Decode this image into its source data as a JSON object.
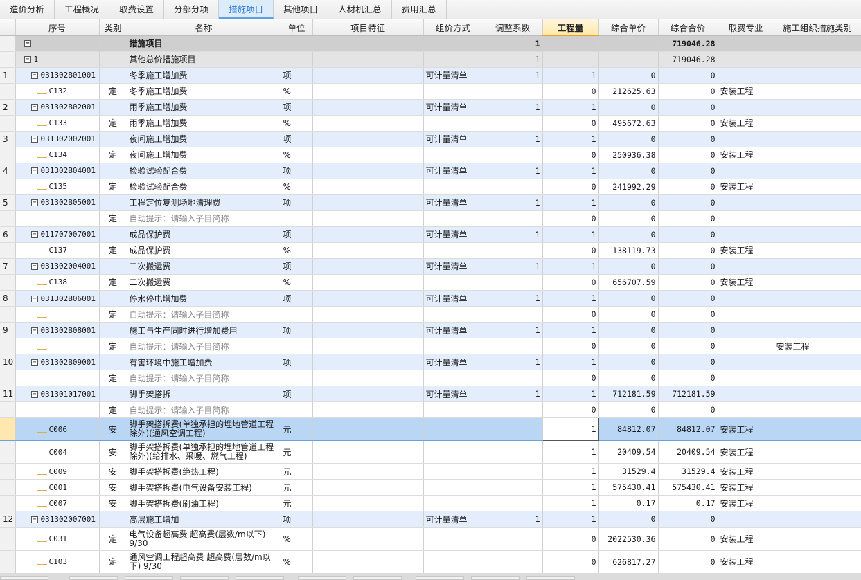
{
  "tabs": [
    {
      "label": "造价分析",
      "active": false
    },
    {
      "label": "工程概况",
      "active": false
    },
    {
      "label": "取费设置",
      "active": false
    },
    {
      "label": "分部分项",
      "active": false
    },
    {
      "label": "措施项目",
      "active": true
    },
    {
      "label": "其他项目",
      "active": false
    },
    {
      "label": "人材机汇总",
      "active": false
    },
    {
      "label": "费用汇总",
      "active": false
    }
  ],
  "columns": {
    "seq": "序号",
    "cat": "类别",
    "name": "名称",
    "unit": "单位",
    "feat": "项目特征",
    "method": "组价方式",
    "coef": "调整系数",
    "qty": "工程量",
    "price": "综合单价",
    "total": "综合合价",
    "spec": "取费专业",
    "org": "施工组织措施类别"
  },
  "rows": [
    {
      "idx": "",
      "type": "head",
      "seq": "",
      "cat": "",
      "name": "措施项目",
      "unit": "",
      "feat": "",
      "method": "",
      "coef": "1",
      "qty": "",
      "price": "",
      "total": "719046.28",
      "spec": "",
      "org": ""
    },
    {
      "idx": "",
      "type": "group",
      "seq": "1",
      "cat": "",
      "name": "其他总价措施项目",
      "unit": "",
      "feat": "",
      "method": "",
      "coef": "1",
      "qty": "",
      "price": "",
      "total": "719046.28",
      "spec": "",
      "org": ""
    },
    {
      "idx": "1",
      "type": "list",
      "seq": "031302B01001",
      "cat": "",
      "name": "冬季施工增加费",
      "unit": "项",
      "feat": "",
      "method": "可计量清单",
      "coef": "1",
      "qty": "1",
      "price": "0",
      "total": "0",
      "spec": "",
      "org": ""
    },
    {
      "idx": "",
      "type": "sub",
      "seq": "C132",
      "cat": "定",
      "name": "冬季施工增加费",
      "unit": "%",
      "feat": "",
      "method": "",
      "coef": "",
      "qty": "0",
      "price": "212625.63",
      "total": "0",
      "spec": "安装工程",
      "org": ""
    },
    {
      "idx": "2",
      "type": "list",
      "seq": "031302B02001",
      "cat": "",
      "name": "雨季施工增加费",
      "unit": "项",
      "feat": "",
      "method": "可计量清单",
      "coef": "1",
      "qty": "1",
      "price": "0",
      "total": "0",
      "spec": "",
      "org": ""
    },
    {
      "idx": "",
      "type": "sub",
      "seq": "C133",
      "cat": "定",
      "name": "雨季施工增加费",
      "unit": "%",
      "feat": "",
      "method": "",
      "coef": "",
      "qty": "0",
      "price": "495672.63",
      "total": "0",
      "spec": "安装工程",
      "org": ""
    },
    {
      "idx": "3",
      "type": "list",
      "seq": "031302002001",
      "cat": "",
      "name": "夜间施工增加费",
      "unit": "项",
      "feat": "",
      "method": "可计量清单",
      "coef": "1",
      "qty": "1",
      "price": "0",
      "total": "0",
      "spec": "",
      "org": ""
    },
    {
      "idx": "",
      "type": "sub",
      "seq": "C134",
      "cat": "定",
      "name": "夜间施工增加费",
      "unit": "%",
      "feat": "",
      "method": "",
      "coef": "",
      "qty": "0",
      "price": "250936.38",
      "total": "0",
      "spec": "安装工程",
      "org": ""
    },
    {
      "idx": "4",
      "type": "list",
      "seq": "031302B04001",
      "cat": "",
      "name": "检验试验配合费",
      "unit": "项",
      "feat": "",
      "method": "可计量清单",
      "coef": "1",
      "qty": "1",
      "price": "0",
      "total": "0",
      "spec": "",
      "org": ""
    },
    {
      "idx": "",
      "type": "sub",
      "seq": "C135",
      "cat": "定",
      "name": "检验试验配合费",
      "unit": "%",
      "feat": "",
      "method": "",
      "coef": "",
      "qty": "0",
      "price": "241992.29",
      "total": "0",
      "spec": "安装工程",
      "org": ""
    },
    {
      "idx": "5",
      "type": "list",
      "seq": "031302B05001",
      "cat": "",
      "name": "工程定位复测场地清理费",
      "unit": "项",
      "feat": "",
      "method": "可计量清单",
      "coef": "1",
      "qty": "1",
      "price": "0",
      "total": "0",
      "spec": "",
      "org": ""
    },
    {
      "idx": "",
      "type": "sub",
      "seq": "",
      "cat": "定",
      "name": "自动提示：请输入子目简称",
      "hint": true,
      "unit": "",
      "feat": "",
      "method": "",
      "coef": "",
      "qty": "0",
      "price": "0",
      "total": "0",
      "spec": "",
      "org": ""
    },
    {
      "idx": "6",
      "type": "list",
      "seq": "011707007001",
      "cat": "",
      "name": "成品保护费",
      "unit": "项",
      "feat": "",
      "method": "可计量清单",
      "coef": "1",
      "qty": "1",
      "price": "0",
      "total": "0",
      "spec": "",
      "org": ""
    },
    {
      "idx": "",
      "type": "sub",
      "seq": "C137",
      "cat": "定",
      "name": "成品保护费",
      "unit": "%",
      "feat": "",
      "method": "",
      "coef": "",
      "qty": "0",
      "price": "138119.73",
      "total": "0",
      "spec": "安装工程",
      "org": ""
    },
    {
      "idx": "7",
      "type": "list",
      "seq": "031302004001",
      "cat": "",
      "name": "二次搬运费",
      "unit": "项",
      "feat": "",
      "method": "可计量清单",
      "coef": "1",
      "qty": "1",
      "price": "0",
      "total": "0",
      "spec": "",
      "org": ""
    },
    {
      "idx": "",
      "type": "sub",
      "seq": "C138",
      "cat": "定",
      "name": "二次搬运费",
      "unit": "%",
      "feat": "",
      "method": "",
      "coef": "",
      "qty": "0",
      "price": "656707.59",
      "total": "0",
      "spec": "安装工程",
      "org": ""
    },
    {
      "idx": "8",
      "type": "list",
      "seq": "031302B06001",
      "cat": "",
      "name": "停水停电增加费",
      "unit": "项",
      "feat": "",
      "method": "可计量清单",
      "coef": "1",
      "qty": "1",
      "price": "0",
      "total": "0",
      "spec": "",
      "org": ""
    },
    {
      "idx": "",
      "type": "sub",
      "seq": "",
      "cat": "定",
      "name": "自动提示：请输入子目简称",
      "hint": true,
      "unit": "",
      "feat": "",
      "method": "",
      "coef": "",
      "qty": "0",
      "price": "0",
      "total": "0",
      "spec": "",
      "org": ""
    },
    {
      "idx": "9",
      "type": "list",
      "seq": "031302B08001",
      "cat": "",
      "name": "施工与生产同时进行增加费用",
      "unit": "项",
      "feat": "",
      "method": "可计量清单",
      "coef": "1",
      "qty": "1",
      "price": "0",
      "total": "0",
      "spec": "",
      "org": ""
    },
    {
      "idx": "",
      "type": "sub",
      "seq": "",
      "cat": "定",
      "name": "自动提示：请输入子目简称",
      "hint": true,
      "unit": "",
      "feat": "",
      "method": "",
      "coef": "",
      "qty": "0",
      "price": "0",
      "total": "0",
      "spec": "",
      "org": "安装工程"
    },
    {
      "idx": "10",
      "type": "list",
      "seq": "031302B09001",
      "cat": "",
      "name": "有害环境中施工增加费",
      "unit": "项",
      "feat": "",
      "method": "可计量清单",
      "coef": "1",
      "qty": "1",
      "price": "0",
      "total": "0",
      "spec": "",
      "org": ""
    },
    {
      "idx": "",
      "type": "sub",
      "seq": "",
      "cat": "定",
      "name": "自动提示：请输入子目简称",
      "hint": true,
      "unit": "",
      "feat": "",
      "method": "",
      "coef": "",
      "qty": "0",
      "price": "0",
      "total": "0",
      "spec": "",
      "org": ""
    },
    {
      "idx": "11",
      "type": "list",
      "seq": "031301017001",
      "cat": "",
      "name": "脚手架搭拆",
      "unit": "项",
      "feat": "",
      "method": "可计量清单",
      "coef": "1",
      "qty": "1",
      "price": "712181.59",
      "total": "712181.59",
      "spec": "",
      "org": ""
    },
    {
      "idx": "",
      "type": "sub",
      "seq": "",
      "cat": "定",
      "name": "自动提示：请输入子目简称",
      "hint": true,
      "unit": "",
      "feat": "",
      "method": "",
      "coef": "",
      "qty": "0",
      "price": "0",
      "total": "0",
      "spec": "",
      "org": ""
    },
    {
      "idx": "",
      "type": "sel",
      "tall": true,
      "seq": "C006",
      "cat": "安",
      "name": "脚手架搭拆费(单独承担的埋地管道工程除外)(通风空调工程)",
      "unit": "元",
      "feat": "",
      "method": "",
      "coef": "",
      "qty": "1",
      "price": "84812.07",
      "total": "84812.07",
      "spec": "安装工程",
      "org": ""
    },
    {
      "idx": "",
      "type": "sub",
      "tall": true,
      "seq": "C004",
      "cat": "安",
      "name": "脚手架搭拆费(单独承担的埋地管道工程除外)(给排水、采暖、燃气工程)",
      "unit": "元",
      "feat": "",
      "method": "",
      "coef": "",
      "qty": "1",
      "price": "20409.54",
      "total": "20409.54",
      "spec": "安装工程",
      "org": ""
    },
    {
      "idx": "",
      "type": "sub",
      "seq": "C009",
      "cat": "安",
      "name": "脚手架搭拆费(绝热工程)",
      "unit": "元",
      "feat": "",
      "method": "",
      "coef": "",
      "qty": "1",
      "price": "31529.4",
      "total": "31529.4",
      "spec": "安装工程",
      "org": ""
    },
    {
      "idx": "",
      "type": "sub",
      "seq": "C001",
      "cat": "安",
      "name": "脚手架搭拆费(电气设备安装工程)",
      "unit": "元",
      "feat": "",
      "method": "",
      "coef": "",
      "qty": "1",
      "price": "575430.41",
      "total": "575430.41",
      "spec": "安装工程",
      "org": ""
    },
    {
      "idx": "",
      "type": "sub",
      "seq": "C007",
      "cat": "安",
      "name": "脚手架搭拆费(刷油工程)",
      "unit": "元",
      "feat": "",
      "method": "",
      "coef": "",
      "qty": "1",
      "price": "0.17",
      "total": "0.17",
      "spec": "安装工程",
      "org": ""
    },
    {
      "idx": "12",
      "type": "list",
      "seq": "031302007001",
      "cat": "",
      "name": "高层施工增加",
      "unit": "项",
      "feat": "",
      "method": "可计量清单",
      "coef": "1",
      "qty": "1",
      "price": "0",
      "total": "0",
      "spec": "",
      "org": ""
    },
    {
      "idx": "",
      "type": "sub",
      "tall": true,
      "seq": "C031",
      "cat": "定",
      "name": "电气设备超高费 超高费(层数/m以下) 9/30",
      "unit": "%",
      "feat": "",
      "method": "",
      "coef": "",
      "qty": "0",
      "price": "2022530.36",
      "total": "0",
      "spec": "安装工程",
      "org": ""
    },
    {
      "idx": "",
      "type": "sub",
      "tall": true,
      "seq": "C103",
      "cat": "定",
      "name": "通风空调工程超高费 超高费(层数/m以下) 9/30",
      "unit": "%",
      "feat": "",
      "method": "",
      "coef": "",
      "qty": "0",
      "price": "626817.27",
      "total": "0",
      "spec": "安装工程",
      "org": ""
    }
  ]
}
